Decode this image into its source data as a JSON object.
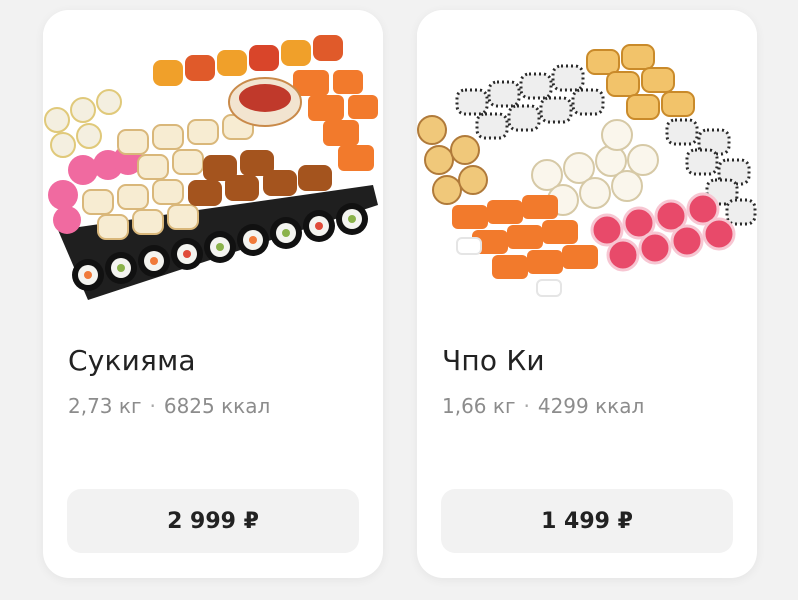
{
  "products": [
    {
      "name": "Сукияма",
      "weight": "2,73 кг",
      "separator": "·",
      "calories": "6825 ккал",
      "price": "2 999 ₽",
      "image_icon": "sushi-set-image"
    },
    {
      "name": "Чпо Ки",
      "weight": "1,66 кг",
      "separator": "·",
      "calories": "4299 ккал",
      "price": "1 499 ₽",
      "image_icon": "sushi-set-image"
    }
  ],
  "colors": {
    "background": "#f2f2f2",
    "card": "#ffffff",
    "title": "#222222",
    "meta": "#8c8c8c",
    "button": "#f2f2f2"
  }
}
